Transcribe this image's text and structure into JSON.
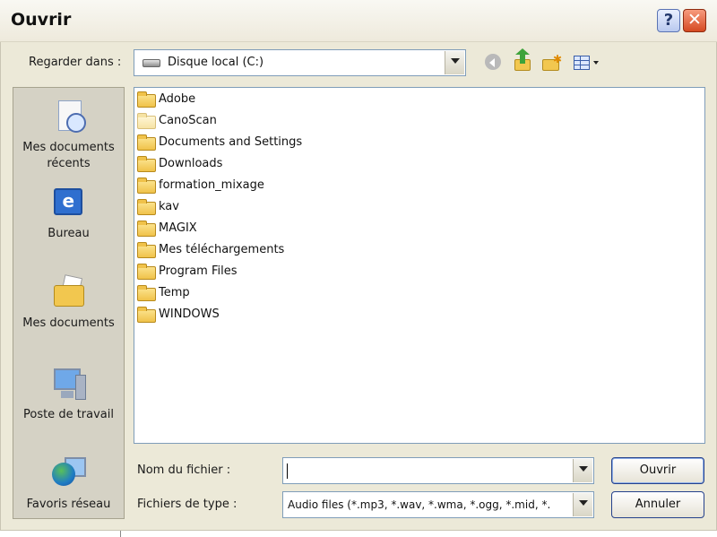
{
  "window": {
    "title": "Ouvrir",
    "help_glyph": "?",
    "close_glyph": "✕"
  },
  "look_in": {
    "label": "Regarder dans :",
    "value": "Disque local (C:)"
  },
  "toolbar": {
    "icons": [
      "back-icon",
      "up-folder-icon",
      "new-folder-icon",
      "views-menu-icon"
    ]
  },
  "places": [
    {
      "label": "Mes documents\nrécents",
      "icon": "recent-documents-icon"
    },
    {
      "label": "Bureau",
      "icon": "desktop-icon"
    },
    {
      "label": "Mes documents",
      "icon": "my-documents-icon"
    },
    {
      "label": "Poste de travail",
      "icon": "my-computer-icon"
    },
    {
      "label": "Favoris réseau",
      "icon": "network-places-icon"
    }
  ],
  "folders": [
    "Adobe",
    "CanoScan",
    "Documents and Settings",
    "Downloads",
    "formation_mixage",
    "kav",
    "MAGIX",
    "Mes téléchargements",
    "Program Files",
    "Temp",
    "WINDOWS"
  ],
  "filename": {
    "label": "Nom du fichier :",
    "value": ""
  },
  "filetype": {
    "label": "Fichiers de type :",
    "value": "Audio files (*.mp3, *.wav, *.wma, *.ogg, *.mid, *."
  },
  "buttons": {
    "open": "Ouvrir",
    "cancel": "Annuler"
  },
  "colors": {
    "dialog_bg": "#ece9d8",
    "places_bg": "#d5d2c5",
    "field_border": "#7f9db9",
    "close_button": "#d54a22"
  }
}
